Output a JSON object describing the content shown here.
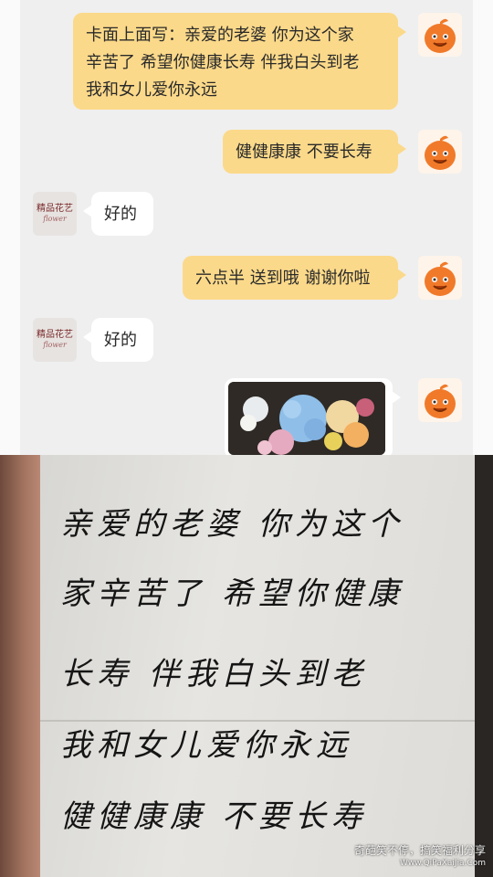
{
  "chat": {
    "messages": [
      {
        "from": "me",
        "text_lines": [
          "卡面上面写：亲爱的老婆 你为这个家",
          "辛苦了 希望你健康长寿 伴我白头到老",
          "我和女儿爱你永远"
        ]
      },
      {
        "from": "me",
        "text": "健健康康 不要长寿"
      },
      {
        "from": "shop",
        "text": "好的"
      },
      {
        "from": "me",
        "text": "六点半 送到哦 谢谢你啦"
      },
      {
        "from": "shop",
        "text": "好的"
      },
      {
        "from": "me",
        "type": "image",
        "icon": "flower-bouquet-photo"
      }
    ],
    "shop_avatar": {
      "line1": "精品花艺",
      "line2": "flower"
    },
    "me_avatar_icon": "orange-mascot-icon",
    "colors": {
      "my_bubble": "#fbd98a",
      "shop_bubble": "#ffffff",
      "background": "#efefef"
    }
  },
  "card": {
    "lines": [
      "亲爱的老婆 你为这个",
      "家辛苦了 希望你健康",
      "长寿 伴我白头到老",
      "我和女儿爱你永远",
      "健健康康 不要长寿"
    ]
  },
  "watermark": {
    "text": "奇葩笑不停，搞笑福利分享",
    "url": "Www.QiPaXaiJia.Com"
  }
}
